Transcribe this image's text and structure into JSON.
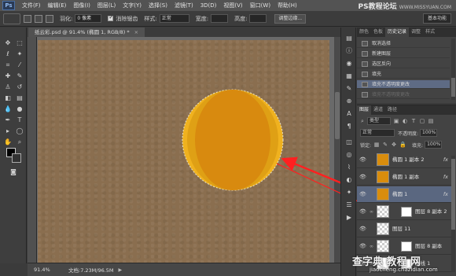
{
  "menubar": {
    "logo": "Ps",
    "items": [
      "文件(F)",
      "编辑(E)",
      "图像(I)",
      "图层(L)",
      "文字(Y)",
      "选择(S)",
      "滤镜(T)",
      "3D(D)",
      "视图(V)",
      "窗口(W)",
      "帮助(H)"
    ],
    "watermark": "PS教程论坛",
    "watermark_sub": "WWW.MISSYUAN.COM"
  },
  "options": {
    "feather_label": "羽化:",
    "feather_value": "0 像素",
    "antialias_label": "消除锯齿",
    "style_label": "样式:",
    "style_value": "正常",
    "width_label": "宽度:",
    "height_label": "高度:",
    "refine_edge": "调整边缘...",
    "workspace": "基本功能"
  },
  "document": {
    "tab_title": "纸云彩.psd @ 91.4% (椭圆 1, RGB/8) *",
    "close": "×"
  },
  "colors": {
    "canvas_bg": "#8a6e4f",
    "orb_outer": "#f0b21f",
    "orb_inner": "#d88a0f",
    "annotation_arrow": "#ff2020"
  },
  "status": {
    "zoom": "91.4%",
    "doc_info": "文档:7.23M/96.5M",
    "arrow": "▶"
  },
  "history": {
    "tabs": [
      "颜色",
      "色板",
      "历史记录",
      "调整",
      "样式"
    ],
    "active_tab": 2,
    "items": [
      {
        "label": "取消选择",
        "state": "normal"
      },
      {
        "label": "新建图层",
        "state": "normal"
      },
      {
        "label": "选区反向",
        "state": "normal"
      },
      {
        "label": "填充",
        "state": "normal"
      },
      {
        "label": "填充不透明度更改",
        "state": "selected"
      },
      {
        "label": "填充不透明度更改",
        "state": "disabled"
      }
    ]
  },
  "layers": {
    "tabs": [
      "图层",
      "通道",
      "路径"
    ],
    "filter_label": "类型",
    "blend_mode": "正常",
    "opacity_label": "不透明度:",
    "opacity_value": "100%",
    "lock_label": "锁定:",
    "fill_label": "填充:",
    "fill_value": "100%",
    "items": [
      {
        "name": "椭圆 1 副本 2",
        "thumb": "orange",
        "fx": "fx",
        "selected": false,
        "mask": false
      },
      {
        "name": "椭圆 1 副本",
        "thumb": "orange",
        "fx": "fx",
        "selected": false,
        "mask": false
      },
      {
        "name": "椭圆 1",
        "thumb": "orange",
        "fx": "fx",
        "selected": true,
        "mask": false
      },
      {
        "name": "图层 8 副本 2",
        "thumb": "check",
        "fx": "",
        "selected": false,
        "mask": true
      },
      {
        "name": "图层 11",
        "thumb": "check",
        "fx": "",
        "selected": false,
        "mask": false
      },
      {
        "name": "图层 8 副本",
        "thumb": "check",
        "fx": "",
        "selected": false,
        "mask": true
      },
      {
        "name": "曲线 1",
        "thumb": "white",
        "fx": "",
        "selected": false,
        "mask": true
      }
    ]
  },
  "watermark_bottom": {
    "big": "查字典 教程 网",
    "small": "jiaocheng.chazidian.com"
  }
}
